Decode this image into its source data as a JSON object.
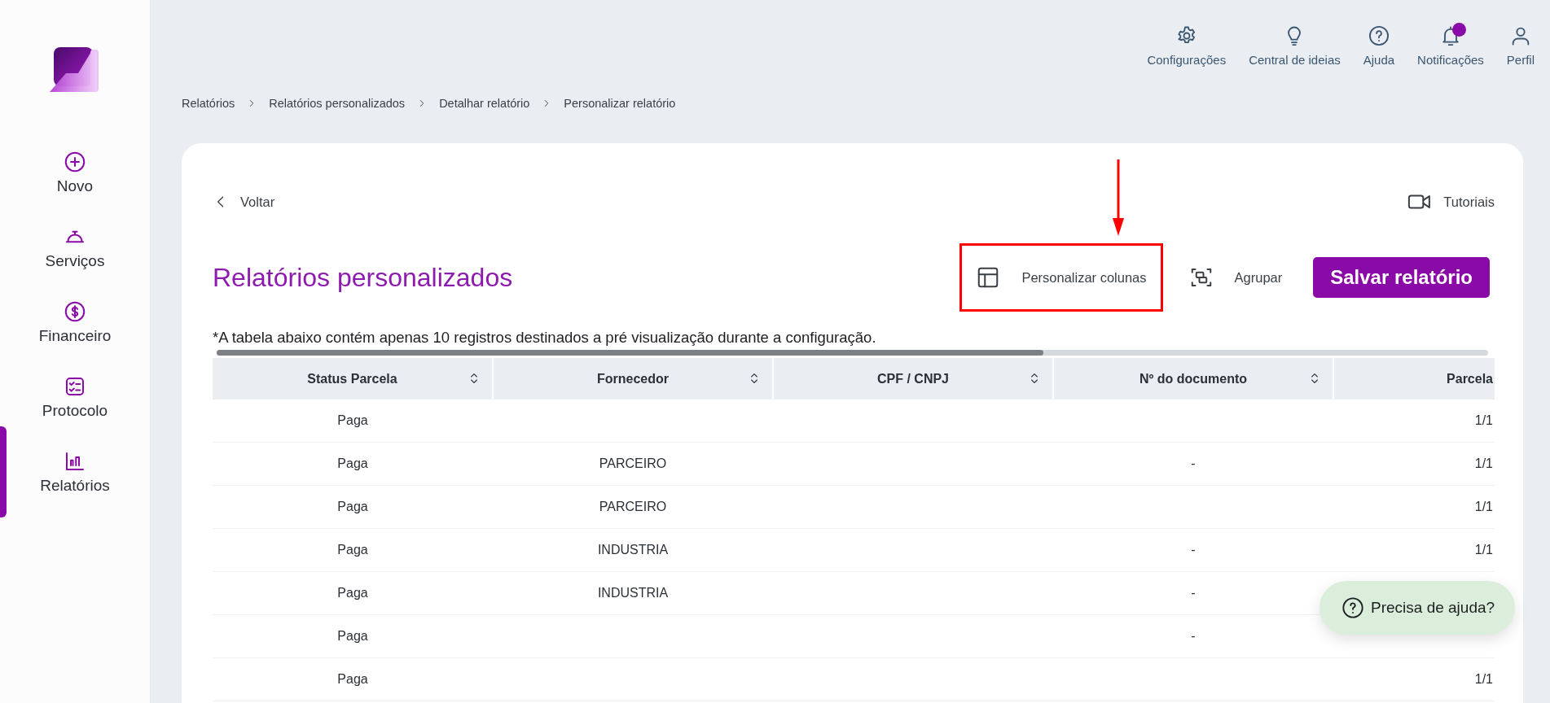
{
  "sidebar": {
    "items": [
      {
        "label": "Novo",
        "selected": false
      },
      {
        "label": "Serviços",
        "selected": false
      },
      {
        "label": "Financeiro",
        "selected": false
      },
      {
        "label": "Protocolo",
        "selected": false
      },
      {
        "label": "Relatórios",
        "selected": true
      }
    ]
  },
  "top_bar": {
    "items": [
      {
        "label": "Configurações",
        "has_unread": false
      },
      {
        "label": "Central de ideias",
        "has_unread": false
      },
      {
        "label": "Ajuda",
        "has_unread": false
      },
      {
        "label": "Notificações",
        "has_unread": true
      },
      {
        "label": "Perfil",
        "has_unread": false
      }
    ]
  },
  "breadcrumb": [
    "Relatórios",
    "Relatórios personalizados",
    "Detalhar relatório",
    "Personalizar relatório"
  ],
  "back_link": "Voltar",
  "tutorials_link": "Tutoriais",
  "title": "Relatórios personalizados",
  "actions": [
    {
      "kind": "columns",
      "label": "Personalizar colunas",
      "highlighted": true
    },
    {
      "kind": "group",
      "label": "Agrupar",
      "highlighted": false
    },
    {
      "kind": "primary",
      "label": "Salvar relatório",
      "highlighted": false
    }
  ],
  "note": "*A tabela abaixo contém apenas 10 registros destinados a pré visualização durante a configuração.",
  "table": {
    "columns": [
      {
        "label": "Status Parcela",
        "sortable": true
      },
      {
        "label": "Fornecedor",
        "sortable": true
      },
      {
        "label": "CPF / CNPJ",
        "sortable": true
      },
      {
        "label": "Nº do documento",
        "sortable": true
      },
      {
        "label": "Parcela",
        "sortable": false
      }
    ],
    "rows": [
      [
        "Paga",
        "",
        "",
        "",
        "1/1"
      ],
      [
        "Paga",
        "PARCEIRO",
        "",
        "-",
        "1/1"
      ],
      [
        "Paga",
        "PARCEIRO",
        "",
        "",
        "1/1"
      ],
      [
        "Paga",
        "INDUSTRIA",
        "",
        "-",
        "1/1"
      ],
      [
        "Paga",
        "INDUSTRIA",
        "",
        "-",
        ""
      ],
      [
        "Paga",
        "",
        "",
        "-",
        ""
      ],
      [
        "Paga",
        "",
        "",
        "",
        "1/1"
      ]
    ]
  },
  "help_button": "Precisa de ajuda?"
}
